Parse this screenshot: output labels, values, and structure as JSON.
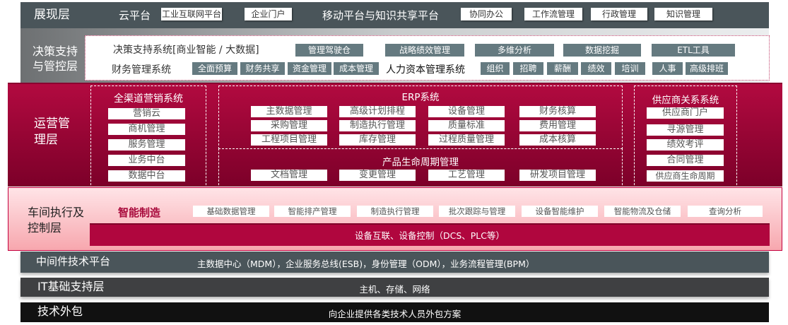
{
  "presentation": {
    "label": "展现层",
    "cloud": {
      "label": "云平台",
      "items": [
        "工业互联网平台",
        "企业门户"
      ]
    },
    "mobile": {
      "label": "移动平台与知识共享平台",
      "items": [
        "协同办公",
        "工作流管理",
        "行政管理",
        "知识管理"
      ]
    }
  },
  "decision": {
    "label": "决策支持与管控层",
    "bi": {
      "label": "决策支持系统[商业智能 / 大数据]",
      "items": [
        "管理驾驶仓",
        "战略绩效管理",
        "多维分析",
        "数据挖掘",
        "ETL工具"
      ]
    },
    "finance": {
      "label": "财务管理系统",
      "items": [
        "全面预算",
        "财务共享",
        "资金管理",
        "成本管理"
      ]
    },
    "hr": {
      "label": "人力资本管理系统",
      "items": [
        "组织",
        "招聘",
        "薪酬",
        "绩效",
        "培训",
        "人事",
        "高级排班"
      ]
    }
  },
  "operation": {
    "label": "运营管理层",
    "marketing": {
      "title": "全渠道营销系统",
      "items": [
        "营销云",
        "商机管理",
        "服务管理",
        "业务中台",
        "数据中台"
      ]
    },
    "erp": {
      "title": "ERP系统",
      "items": [
        "主数据管理",
        "高级计划排程",
        "设备管理",
        "财务核算",
        "采购管理",
        "制造执行管理",
        "质量标准",
        "费用管理",
        "工程项目管理",
        "库存管理",
        "过程质量管理",
        "成本核算"
      ]
    },
    "plm": {
      "title": "产品生命周期管理",
      "items": [
        "文档管理",
        "变更管理",
        "工艺管理",
        "研发项目管理"
      ]
    },
    "srm": {
      "title": "供应商关系系统",
      "items": [
        "供应商门户",
        "寻源管理",
        "绩效考评",
        "合同管理",
        "供应商生命周期"
      ]
    }
  },
  "workshop": {
    "label": "车间执行及控制层",
    "smart": "智能制造",
    "items": [
      "基础数据管理",
      "智能排产管理",
      "制造执行管理",
      "批次跟踪与管理",
      "设备智能维护",
      "智能物流及仓储",
      "查询分析"
    ],
    "control": "设备互联、设备控制（DCS、PLC等）"
  },
  "middleware": {
    "label": "中间件技术平台",
    "content": "主数据中心（MDM），企业服务总线(ESB)，身份管理（ODM），业务流程管理(BPM）"
  },
  "it": {
    "label": "IT基础支持层",
    "content": "主机、存储、网络"
  },
  "outsourcing": {
    "label": "技术外包",
    "content": "向企业提供各类技术人员外包方案"
  },
  "colors": {
    "dark": "#4a555a",
    "crimson": "#a80a3c",
    "pink": "#fbc5ca",
    "gray_button": "#657a80"
  }
}
